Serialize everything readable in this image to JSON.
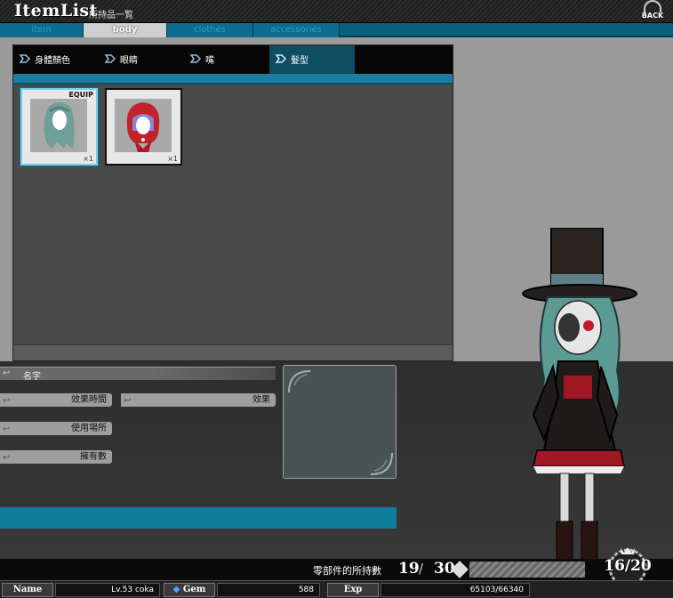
{
  "header": {
    "title": "ItemList",
    "subtitle": "所持品一覧",
    "back_label": "BACK"
  },
  "category_tabs": [
    {
      "label": "item",
      "active": false
    },
    {
      "label": "body",
      "active": true
    },
    {
      "label": "clothes",
      "active": false
    },
    {
      "label": "accessories",
      "active": false
    }
  ],
  "sub_tabs": [
    {
      "label": "身體顏色",
      "active": false
    },
    {
      "label": "眼睛",
      "active": false
    },
    {
      "label": "嘴",
      "active": false
    },
    {
      "label": "髮型",
      "active": true
    }
  ],
  "items": [
    {
      "name": "teal-long-hair",
      "count": "×1",
      "equipped": true,
      "equip_label": "EQUIP"
    },
    {
      "name": "red-hood",
      "count": "×1",
      "equipped": false
    }
  ],
  "detail": {
    "name_label": "名字",
    "duration_label": "效果時間",
    "effect_label": "效果",
    "usage_label": "使用場所",
    "owned_label": "擁有數"
  },
  "part_count": {
    "label": "零部件的所持數",
    "owned": "19",
    "separator": "/",
    "max": "30"
  },
  "level_badge": "16/20",
  "status": {
    "name_label": "Name",
    "name_value": "Lv.53 coka",
    "gem_label": "Gem",
    "gem_value": "588",
    "exp_label": "Exp",
    "exp_value": "65103/66340"
  },
  "colors": {
    "accent": "#117d9c",
    "tab_bg": "#0b5f7e",
    "panel": "#4a4a4a"
  }
}
